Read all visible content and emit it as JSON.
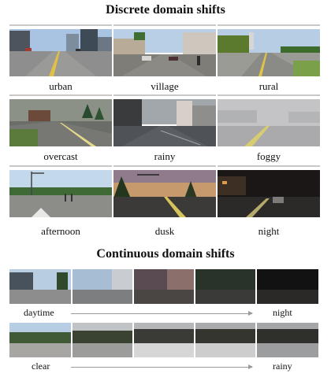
{
  "discrete": {
    "title": "Discrete domain shifts",
    "items": [
      {
        "label": "urban"
      },
      {
        "label": "village"
      },
      {
        "label": "rural"
      },
      {
        "label": "overcast"
      },
      {
        "label": "rainy"
      },
      {
        "label": "foggy"
      },
      {
        "label": "afternoon"
      },
      {
        "label": "dusk"
      },
      {
        "label": "night"
      }
    ]
  },
  "continuous": {
    "title": "Continuous domain shifts",
    "rows": [
      {
        "start": "daytime",
        "end": "night"
      },
      {
        "start": "clear",
        "end": "rainy"
      }
    ]
  }
}
